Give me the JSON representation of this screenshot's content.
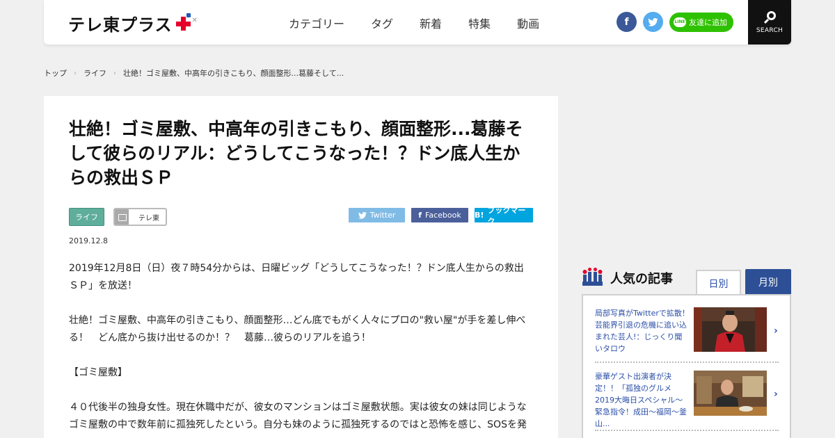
{
  "header": {
    "logo_text": "テレ東プラス",
    "nav": [
      "カテゴリー",
      "タグ",
      "新着",
      "特集",
      "動画"
    ],
    "line_label": "友達に追加",
    "search_label": "SEARCH"
  },
  "breadcrumb": [
    "トップ",
    "ライフ",
    "壮絶！ゴミ屋敷、中高年の引きこもり、顔面整形...葛藤そして..."
  ],
  "article": {
    "title": "壮絶！ゴミ屋敷、中高年の引きこもり、顔面整形...葛藤そして彼らのリアル：どうしてこうなった！？ドン底人生からの救出ＳＰ",
    "category_tag": "ライフ",
    "channel_tag": "テレ東",
    "share": {
      "twitter": "Twitter",
      "facebook": "Facebook",
      "hatena": "ブックマーク",
      "hatena_mark": "B!"
    },
    "date": "2019.12.8",
    "paragraphs": [
      "2019年12月8日（日）夜７時54分からは、日曜ビッグ「どうしてこうなった！？ドン底人生からの救出ＳＰ」を放送！",
      "壮絶！ゴミ屋敷、中高年の引きこもり、顔面整形…どん底でもがく人々にプロの\"救い屋\"が手を差し伸べる！　どん底から抜け出せるのか！？　葛藤…彼らのリアルを追う！",
      "【ゴミ屋敷】",
      "４０代後半の独身女性。現在休職中だが、彼女のマンションはゴミ屋敷状態。実は彼女の妹は同じようなゴミ屋敷の中で数年前に孤独死したという。自分も妹のように孤独死するのではと恐怖を感じ、SOSを発"
    ]
  },
  "ranking": {
    "title": "人気の記事",
    "tab_daily": "日別",
    "tab_monthly": "月別",
    "items": [
      {
        "text": "局部写真がTwitterで拡散！芸能界引退の危機に追い込まれた芸人!：じっくり聞いタロウ"
      },
      {
        "text": "豪華ゲスト出演者が決定！！「孤独のグルメ2019大晦日スペシャル～緊急指令！成田～福岡～釜山..."
      }
    ]
  },
  "colors": {
    "accent_blue": "#2d4f96",
    "logo_red": "#e4002b",
    "line_green": "#2ec100",
    "tag_green": "#5fae9b"
  }
}
